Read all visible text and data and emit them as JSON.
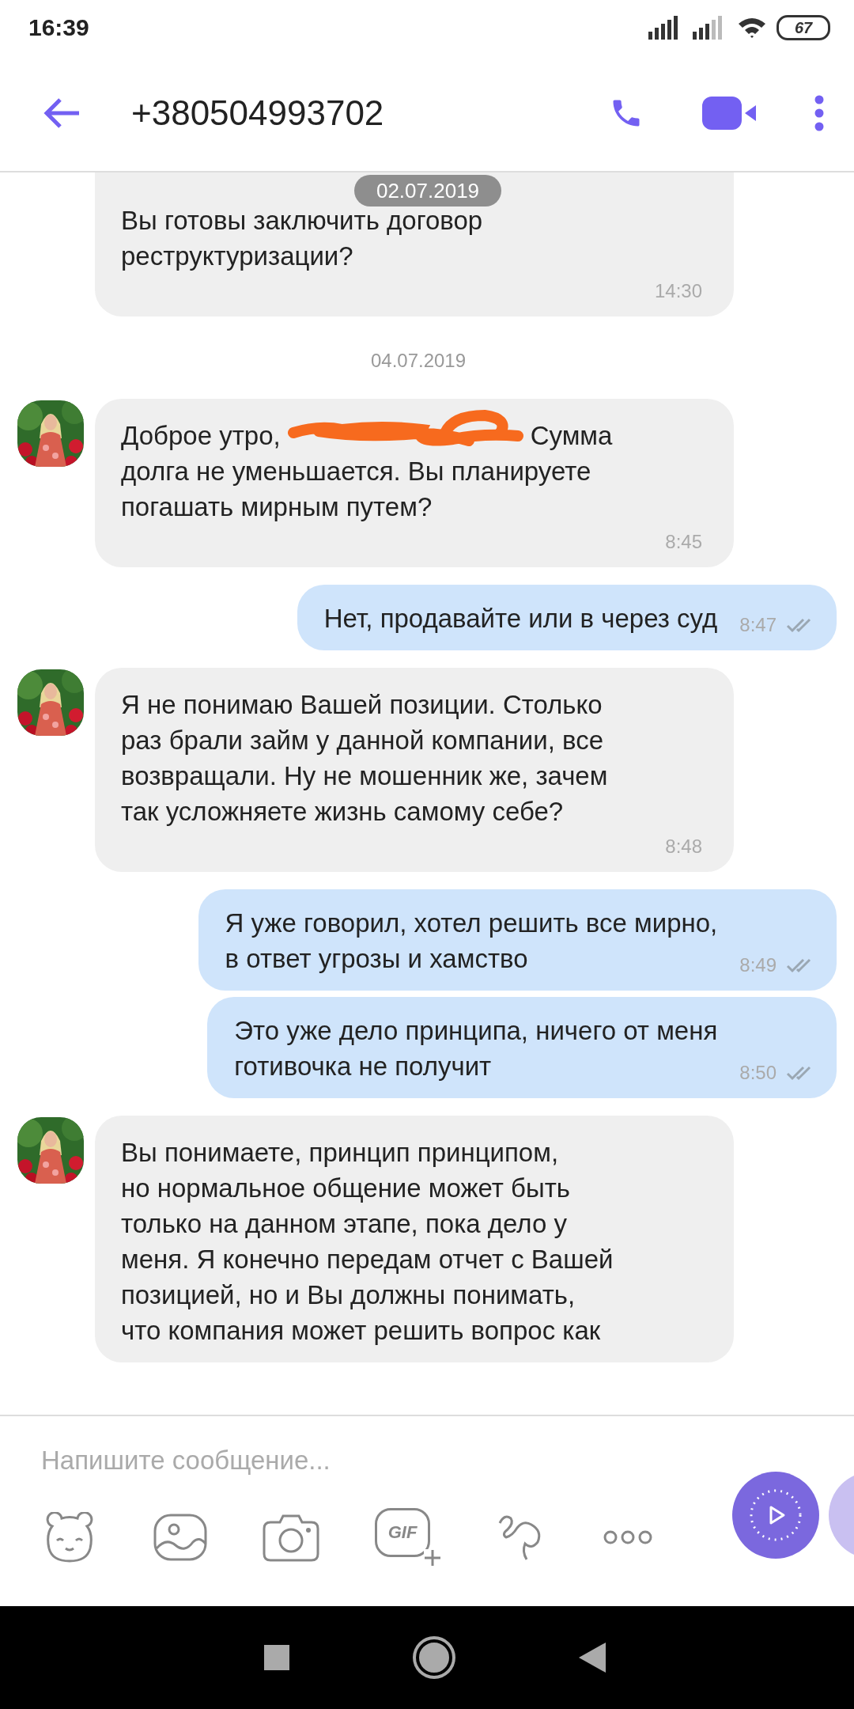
{
  "status_bar": {
    "time": "16:39",
    "battery": "67"
  },
  "header": {
    "title": "+380504993702"
  },
  "date_overlay": "02.07.2019",
  "messages": [
    {
      "kind": "in",
      "parts": [
        "Вы готовы заключить договор\nреструктуризации?"
      ],
      "time": "14:30"
    },
    {
      "kind": "date",
      "text": "04.07.2019"
    },
    {
      "kind": "in",
      "parts": [
        "Доброе утро,",
        "Сумма",
        "долга не уменьшается. Вы планируете\nпогашать мирным путем?"
      ],
      "time": "8:45"
    },
    {
      "kind": "out",
      "parts": [
        "Нет, продавайте или в через суд"
      ],
      "time": "8:47"
    },
    {
      "kind": "in",
      "parts": [
        "Я не понимаю Вашей позиции. Столько\nраз брали займ у данной компании, все\nвозвращали. Ну не мошенник же, зачем\nтак усложняете жизнь самому себе?"
      ],
      "time": "8:48"
    },
    {
      "kind": "out",
      "parts": [
        "Я уже говорил, хотел решить все мирно,\nв ответ угрозы и хамство"
      ],
      "time": "8:49"
    },
    {
      "kind": "out",
      "parts": [
        "Это уже дело принципа, ничего от меня\nготивочка не получит"
      ],
      "time": "8:50"
    },
    {
      "kind": "in",
      "parts": [
        "Вы понимаете, принцип принципом,\nно нормальное общение может быть\nтолько на данном этапе, пока дело у\nменя. Я конечно передам отчет с Вашей\nпозицией, но и Вы должны понимать,\nчто компания может решить вопрос как"
      ]
    }
  ],
  "composer": {
    "placeholder": "Напишите сообщение..."
  },
  "toolbar": [
    {
      "kind": "sticker"
    },
    {
      "kind": "gallery"
    },
    {
      "kind": "camera"
    },
    {
      "kind": "gif",
      "label": "GIF"
    },
    {
      "kind": "doodle"
    },
    {
      "kind": "more"
    }
  ]
}
